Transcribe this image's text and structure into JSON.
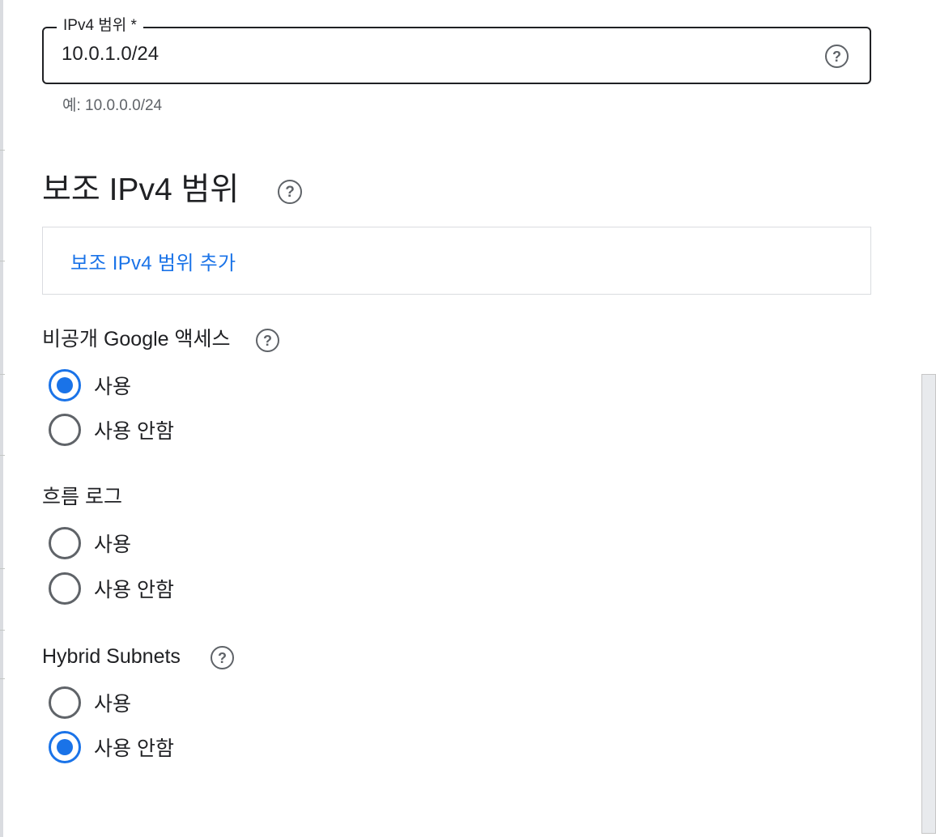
{
  "ipv4_field": {
    "label": "IPv4 범위 *",
    "value": "10.0.1.0/24",
    "hint": "예: 10.0.0.0/24",
    "help_icon": "help-circle-icon"
  },
  "secondary_ranges": {
    "title": "보조 IPv4 범위",
    "help_icon": "help-circle-icon",
    "add_link": "보조 IPv4 범위 추가"
  },
  "private_google_access": {
    "label": "비공개 Google 액세스",
    "help_icon": "help-circle-icon",
    "options": [
      {
        "label": "사용",
        "checked": true
      },
      {
        "label": "사용 안함",
        "checked": false
      }
    ]
  },
  "flow_logs": {
    "label": "흐름 로그",
    "options": [
      {
        "label": "사용",
        "checked": false
      },
      {
        "label": "사용 안함",
        "checked": false
      }
    ]
  },
  "hybrid_subnets": {
    "label": "Hybrid Subnets",
    "help_icon": "help-circle-icon",
    "options": [
      {
        "label": "사용",
        "checked": false
      },
      {
        "label": "사용 안함",
        "checked": true
      }
    ]
  },
  "colors": {
    "accent": "#1a73e8",
    "text": "#202124",
    "secondary_text": "#5f6368",
    "border": "#dadce0"
  }
}
